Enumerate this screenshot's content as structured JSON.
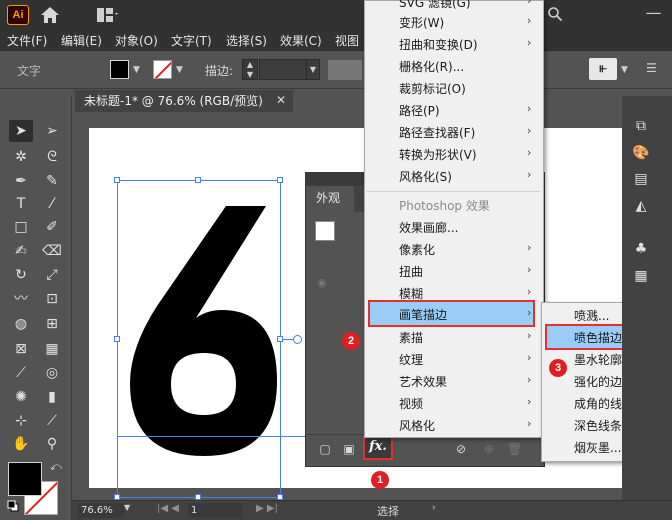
{
  "app": {
    "logo": "Ai",
    "minimize": "—"
  },
  "menubar": [
    {
      "label": "文件(F)"
    },
    {
      "label": "编辑(E)"
    },
    {
      "label": "对象(O)"
    },
    {
      "label": "文字(T)"
    },
    {
      "label": "选择(S)"
    },
    {
      "label": "效果(C)"
    },
    {
      "label": "视图"
    }
  ],
  "controlbar": {
    "label": "文字",
    "stroke_label": "描边:"
  },
  "document": {
    "tab_title": "未标题-1* @ 76.6% (RGB/预览)",
    "glyph": "6"
  },
  "appearance_panel": {
    "tab": "外观"
  },
  "effect_menu": {
    "items": [
      {
        "label": "SVG 滤镜(G)",
        "arrow": true
      },
      {
        "label": "变形(W)",
        "arrow": true
      },
      {
        "label": "扭曲和变换(D)",
        "arrow": true
      },
      {
        "label": "栅格化(R)...",
        "arrow": false
      },
      {
        "label": "裁剪标记(O)",
        "arrow": false
      },
      {
        "label": "路径(P)",
        "arrow": true
      },
      {
        "label": "路径查找器(F)",
        "arrow": true
      },
      {
        "label": "转换为形状(V)",
        "arrow": true
      },
      {
        "label": "风格化(S)",
        "arrow": true
      },
      {
        "label": "Photoshop 效果",
        "arrow": false
      },
      {
        "label": "效果画廊...",
        "arrow": false
      },
      {
        "label": "像素化",
        "arrow": true
      },
      {
        "label": "扭曲",
        "arrow": true
      },
      {
        "label": "模糊",
        "arrow": true
      },
      {
        "label": "画笔描边",
        "arrow": true
      },
      {
        "label": "素描",
        "arrow": true
      },
      {
        "label": "纹理",
        "arrow": true
      },
      {
        "label": "艺术效果",
        "arrow": true
      },
      {
        "label": "视频",
        "arrow": true
      },
      {
        "label": "风格化",
        "arrow": true
      }
    ],
    "highlighted": "画笔描边"
  },
  "submenu": {
    "items": [
      {
        "label": "喷溅..."
      },
      {
        "label": "喷色描边..."
      },
      {
        "label": "墨水轮廓..."
      },
      {
        "label": "强化的边缘..."
      },
      {
        "label": "成角的线条..."
      },
      {
        "label": "深色线条..."
      },
      {
        "label": "烟灰墨..."
      }
    ],
    "highlighted": "喷色描边..."
  },
  "fx_button": "fx.",
  "badges": [
    "1",
    "2",
    "3"
  ],
  "statusbar": {
    "zoom": "76.6%",
    "page": "1",
    "status": "选择"
  },
  "colors": {
    "highlight": "#99ccf7",
    "annotation_red": "#e03030",
    "selection_blue": "#4a7df0"
  }
}
